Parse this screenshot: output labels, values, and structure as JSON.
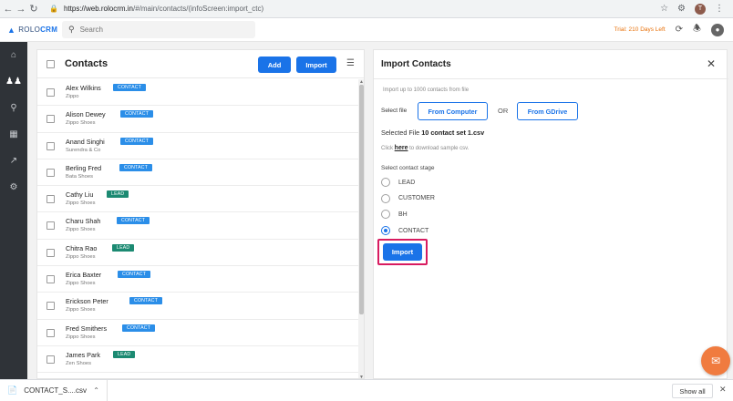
{
  "browser": {
    "url_host": "https://web.rolocrm.in",
    "url_path": "/#/main/contacts/(infoScreen:import_ctc)",
    "profile_initial": "T"
  },
  "app": {
    "logo_rolo": "ROLO",
    "logo_crm": "CRM",
    "search_placeholder": "Search",
    "trial_text": "Trial: 210 Days Left",
    "accent_color": "#1a73e8",
    "trial_color": "#e8710a"
  },
  "sidebar": {
    "items": [
      {
        "icon": "home-icon"
      },
      {
        "icon": "people-icon",
        "active": true
      },
      {
        "icon": "map-pin-icon"
      },
      {
        "icon": "calendar-icon"
      },
      {
        "icon": "trend-icon"
      },
      {
        "icon": "gear-icon"
      }
    ]
  },
  "contacts": {
    "title": "Contacts",
    "add_label": "Add",
    "import_label": "Import",
    "rows": [
      {
        "name": "Alex Wilkins",
        "company": "Zippo",
        "stage": "CONTACT"
      },
      {
        "name": "Alison Dewey",
        "company": "Zippo Shoes",
        "stage": "CONTACT"
      },
      {
        "name": "Anand Singhi",
        "company": "Surendra & Co",
        "stage": "CONTACT"
      },
      {
        "name": "Berling Fred",
        "company": "Bata Shoes",
        "stage": "CONTACT"
      },
      {
        "name": "Cathy Liu",
        "company": "Zippo Shoes",
        "stage": "LEAD"
      },
      {
        "name": "Charu  Shah",
        "company": "Zippo Shoes",
        "stage": "CONTACT"
      },
      {
        "name": "Chitra Rao",
        "company": "Zippo Shoes",
        "stage": "LEAD"
      },
      {
        "name": "Erica Baxter",
        "company": "Zippo Shoes",
        "stage": "CONTACT"
      },
      {
        "name": "Erickson Peter",
        "company": "Zippo Shoes",
        "stage": "CONTACT"
      },
      {
        "name": "Fred Smithers",
        "company": "Zippo Shoes",
        "stage": "CONTACT"
      },
      {
        "name": "James Park",
        "company": "Zen Shoes",
        "stage": "LEAD"
      }
    ],
    "badge_colors": {
      "CONTACT": "#2b8ee8",
      "LEAD": "#1c8a72"
    }
  },
  "import_panel": {
    "title": "Import Contacts",
    "hint": "Import up to 1000 contacts from file",
    "select_file_label": "Select file",
    "from_computer_label": "From Computer",
    "or_label": "OR",
    "from_gdrive_label": "From GDrive",
    "selected_file_prefix": "Selected File",
    "selected_file_name": "10 contact set 1.csv",
    "download_prefix": "Click",
    "download_link": "here",
    "download_suffix": "to download sample csv.",
    "stage_label": "Select contact stage",
    "stages": [
      "LEAD",
      "CUSTOMER",
      "BH",
      "CONTACT"
    ],
    "selected_stage": "CONTACT",
    "import_label": "Import",
    "highlight_color": "#d81b60"
  },
  "download_bar": {
    "file_name": "CONTACT_S....csv",
    "show_all_label": "Show all"
  }
}
